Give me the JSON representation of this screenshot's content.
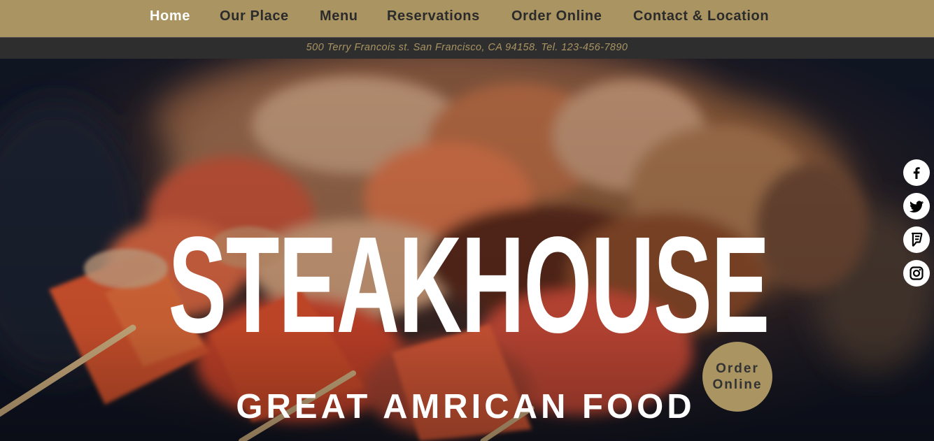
{
  "nav": {
    "items": [
      {
        "label": "Home",
        "active": true
      },
      {
        "label": "Our Place",
        "active": false
      },
      {
        "label": "Menu",
        "active": false
      },
      {
        "label": "Reservations",
        "active": false
      },
      {
        "label": "Order Online",
        "active": false
      },
      {
        "label": "Contact & Location",
        "active": false
      }
    ]
  },
  "address": "500 Terry Francois st. San Francisco, CA 94158. Tel. 123-456-7890",
  "hero": {
    "title": "STEAKHOUSE",
    "subtitle": "GREAT AMRICAN FOOD",
    "order_button": "Order Online"
  },
  "social": [
    {
      "icon": "facebook-icon"
    },
    {
      "icon": "twitter-icon"
    },
    {
      "icon": "foursquare-icon"
    },
    {
      "icon": "instagram-icon"
    }
  ],
  "colors": {
    "brand_gold": "#a99462",
    "nav_text": "#2b2b2b",
    "address_bar": "#2e2e2e",
    "hero_text": "#ffffff"
  }
}
